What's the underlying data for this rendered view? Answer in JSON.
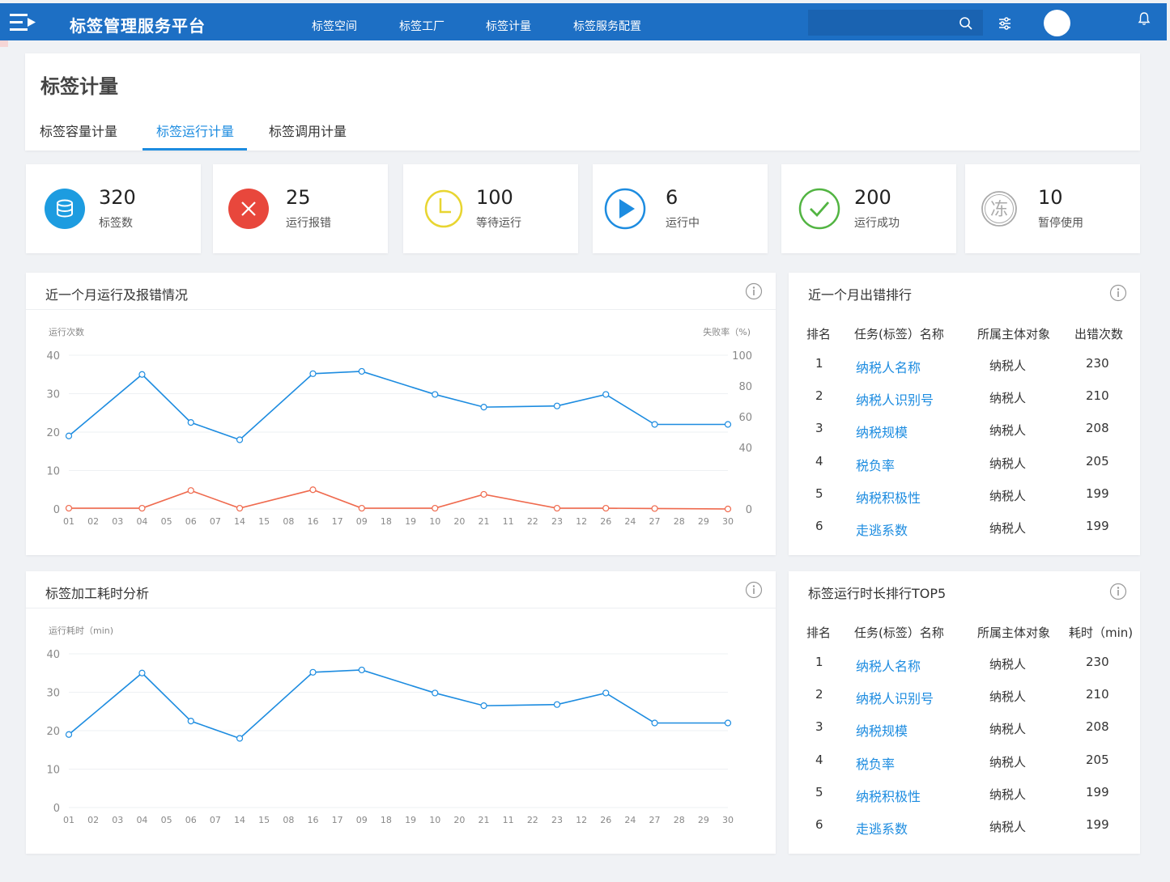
{
  "app": {
    "title": "标签管理服务平台",
    "nav": [
      "标签空间",
      "标签工厂",
      "标签计量",
      "标签服务配置"
    ],
    "search": {
      "placeholder": ""
    },
    "icons": {
      "menu": "menu-icon",
      "search": "search-icon",
      "filter": "sliders-icon",
      "avatar": "avatar",
      "bell": "bell-icon"
    }
  },
  "page": {
    "title": "标签计量",
    "tabs": [
      "标签容量计量",
      "标签运行计量",
      "标签调用计量"
    ],
    "active_tab": 1
  },
  "stats": [
    {
      "value": "320",
      "label": "标签数",
      "icon": "database-icon",
      "color": "#1d9ce0"
    },
    {
      "value": "25",
      "label": "运行报错",
      "icon": "error-x-icon",
      "color": "#e8473c"
    },
    {
      "value": "100",
      "label": "等待运行",
      "icon": "clock-icon",
      "color": "#e8d531"
    },
    {
      "value": "6",
      "label": "运行中",
      "icon": "play-icon",
      "color": "#1d8ce0"
    },
    {
      "value": "200",
      "label": "运行成功",
      "icon": "check-icon",
      "color": "#52b442"
    },
    {
      "value": "10",
      "label": "暂停使用",
      "icon": "frozen-icon",
      "color": "#aaaaaa",
      "glyph": "冻"
    }
  ],
  "panels": {
    "run_errors": {
      "title": "近一个月运行及报错情况"
    },
    "error_rank": {
      "title": "近一个月出错排行",
      "headers": [
        "排名",
        "任务(标签）名称",
        "所属主体对象",
        "出错次数"
      ],
      "rows": [
        {
          "rank": "1",
          "name": "纳税人名称",
          "subject": "纳税人",
          "count": "230"
        },
        {
          "rank": "2",
          "name": "纳税人识别号",
          "subject": "纳税人",
          "count": "210"
        },
        {
          "rank": "3",
          "name": "纳税规模",
          "subject": "纳税人",
          "count": "208"
        },
        {
          "rank": "4",
          "name": "税负率",
          "subject": "纳税人",
          "count": "205"
        },
        {
          "rank": "5",
          "name": "纳税积极性",
          "subject": "纳税人",
          "count": "199"
        },
        {
          "rank": "6",
          "name": "走逃系数",
          "subject": "纳税人",
          "count": "199"
        }
      ]
    },
    "processing_time": {
      "title": "标签加工耗时分析"
    },
    "runtime_rank": {
      "title": "标签运行时长排行TOP5",
      "headers": [
        "排名",
        "任务(标签）名称",
        "所属主体对象",
        "耗时（min)"
      ],
      "rows": [
        {
          "rank": "1",
          "name": "纳税人名称",
          "subject": "纳税人",
          "count": "230"
        },
        {
          "rank": "2",
          "name": "纳税人识别号",
          "subject": "纳税人",
          "count": "210"
        },
        {
          "rank": "3",
          "name": "纳税规模",
          "subject": "纳税人",
          "count": "208"
        },
        {
          "rank": "4",
          "name": "税负率",
          "subject": "纳税人",
          "count": "205"
        },
        {
          "rank": "5",
          "name": "纳税积极性",
          "subject": "纳税人",
          "count": "199"
        },
        {
          "rank": "6",
          "name": "走逃系数",
          "subject": "纳税人",
          "count": "199"
        }
      ]
    }
  },
  "chart_data": [
    {
      "type": "line",
      "x": [
        "01",
        "02",
        "03",
        "04",
        "05",
        "06",
        "07",
        "14",
        "15",
        "08",
        "16",
        "17",
        "09",
        "18",
        "19",
        "10",
        "20",
        "21",
        "11",
        "22",
        "23",
        "12",
        "26",
        "24",
        "27",
        "28",
        "29",
        "30"
      ],
      "point_x_indices": [
        0,
        3,
        5,
        7,
        10,
        12,
        15,
        17,
        20,
        22,
        24,
        27
      ],
      "series": [
        {
          "axis": "left",
          "color": "#1d8ce0",
          "values": [
            19,
            35,
            22.5,
            18,
            35.2,
            35.8,
            29.8,
            26.5,
            26.8,
            29.8,
            22,
            22
          ]
        },
        {
          "axis": "right",
          "color": "#ef6a4e",
          "values": [
            0.5,
            0.5,
            12,
            0.5,
            12.5,
            0.5,
            0.5,
            9.5,
            0.5,
            0.5,
            0.3,
            0
          ]
        }
      ],
      "ylabel": "运行次数",
      "ylabel_right": "失败率（%)",
      "ylim": [
        0,
        40
      ],
      "yticks": [
        0,
        10,
        20,
        30,
        40
      ],
      "ylim_right": [
        0,
        100
      ],
      "yticks_right": [
        0,
        40,
        60,
        80,
        100
      ],
      "grid": true
    },
    {
      "type": "line",
      "x": [
        "01",
        "02",
        "03",
        "04",
        "05",
        "06",
        "07",
        "14",
        "15",
        "08",
        "16",
        "17",
        "09",
        "18",
        "19",
        "10",
        "20",
        "21",
        "11",
        "22",
        "23",
        "12",
        "26",
        "24",
        "27",
        "28",
        "29",
        "30"
      ],
      "point_x_indices": [
        0,
        3,
        5,
        7,
        10,
        12,
        15,
        17,
        20,
        22,
        24,
        27
      ],
      "series": [
        {
          "color": "#1d8ce0",
          "values": [
            19,
            35,
            22.5,
            18,
            35.2,
            35.8,
            29.8,
            26.5,
            26.8,
            29.8,
            22,
            22
          ]
        }
      ],
      "ylabel": "运行耗时（min)",
      "ylim": [
        0,
        40
      ],
      "yticks": [
        0,
        10,
        20,
        30,
        40
      ],
      "grid": true
    }
  ]
}
